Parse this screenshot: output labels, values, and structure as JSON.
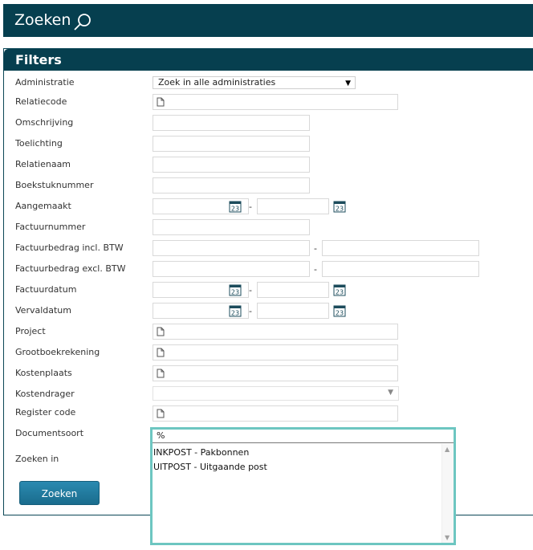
{
  "header": {
    "title": "Zoeken",
    "icon": "search-icon"
  },
  "panel": {
    "title": "Filters"
  },
  "labels": {
    "administratie": "Administratie",
    "relatiecode": "Relatiecode",
    "omschrijving": "Omschrijving",
    "toelichting": "Toelichting",
    "relatienaam": "Relatienaam",
    "boekstuknummer": "Boekstuknummer",
    "aangemaakt": "Aangemaakt",
    "factuurnummer": "Factuurnummer",
    "factuurbedrag_incl": "Factuurbedrag incl. BTW",
    "factuurbedrag_excl": "Factuurbedrag excl. BTW",
    "factuurdatum": "Factuurdatum",
    "vervaldatum": "Vervaldatum",
    "project": "Project",
    "grootboekrekening": "Grootboekrekening",
    "kostenplaats": "Kostenplaats",
    "kostendrager": "Kostendrager",
    "register_code": "Register code",
    "documentsoort": "Documentsoort",
    "zoeken_in": "Zoeken in"
  },
  "administratie_select": {
    "value": "Zoek in alle administraties"
  },
  "range_separator": "-",
  "calendar_icon": "23",
  "documentsoort": {
    "filter_value": "%",
    "options": [
      "INKPOST - Pakbonnen",
      "UITPOST - Uitgaande post"
    ]
  },
  "search_button": {
    "label": "Zoeken"
  },
  "colors": {
    "header_bg": "#063f4f",
    "button": "#1f7a9e",
    "listbox_border": "#6dc6c1"
  }
}
